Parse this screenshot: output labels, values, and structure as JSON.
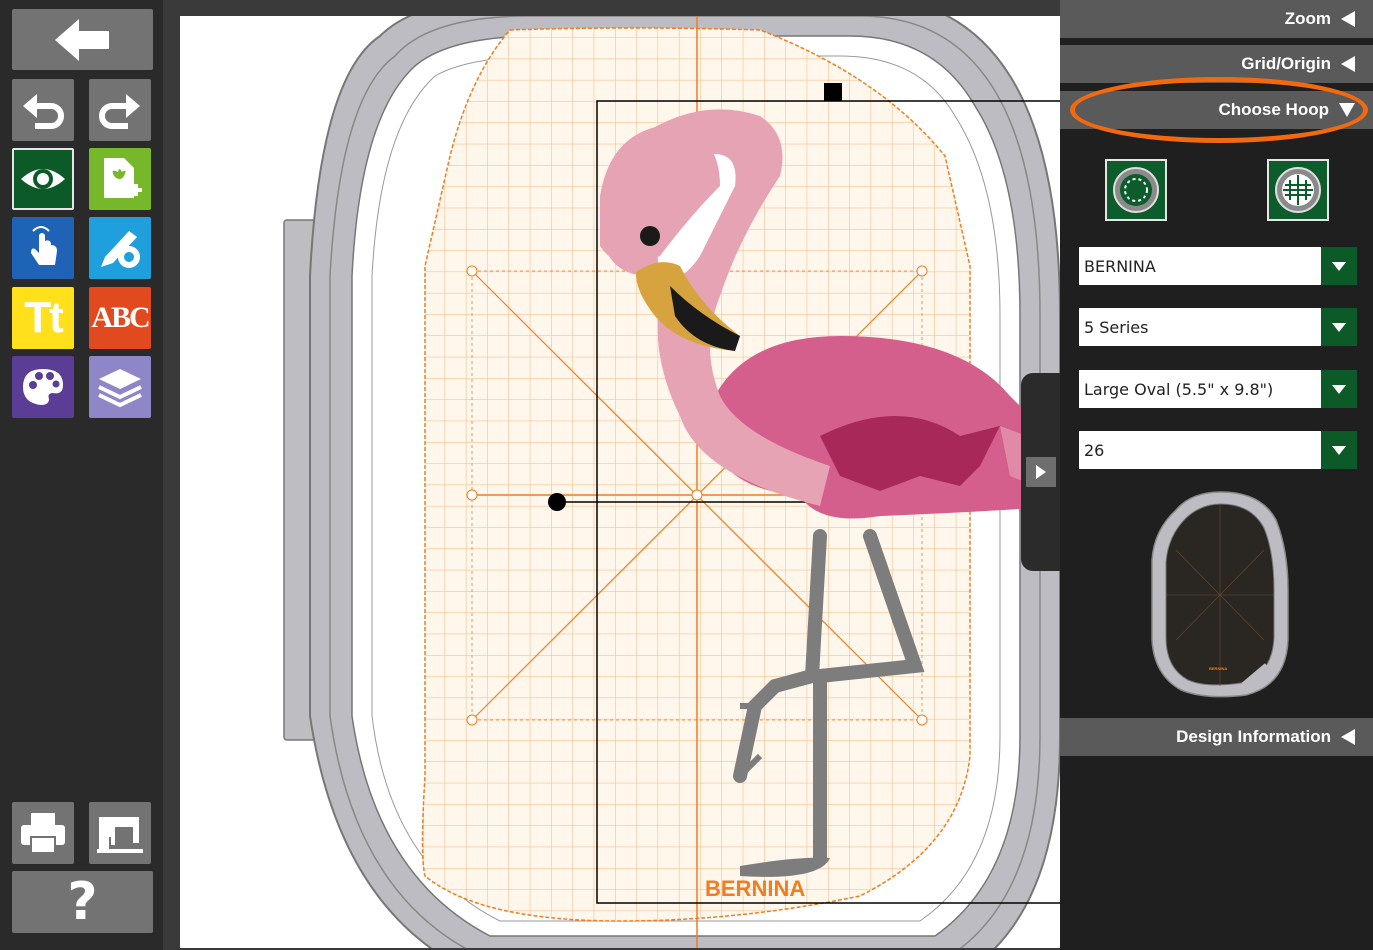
{
  "toolbar": {
    "back": "back-arrow-icon",
    "undo": "undo-icon",
    "redo": "redo-icon",
    "preview": "eye-icon",
    "add_design": "add-design-icon",
    "select": "hand-pointer-icon",
    "edit": "pencil-gear-icon",
    "text": "Tt",
    "monogram": "ABC",
    "colors": "palette-icon",
    "layers": "layers-icon",
    "print": "printer-icon",
    "send_machine": "sewing-machine-icon",
    "help": "?"
  },
  "canvas": {
    "hoop_logo": "BERNINA",
    "accent_color": "#f07d1f"
  },
  "panel": {
    "zoom_label": "Zoom",
    "grid_label": "Grid/Origin",
    "choose_hoop_label": "Choose Hoop",
    "design_info_label": "Design Information",
    "brand_value": "BERNINA",
    "series_value": "5 Series",
    "hoop_value": "Large Oval (5.5\" x 9.8\")",
    "number_value": "26",
    "preview_logo": "BERNINA"
  },
  "colors": {
    "accent_orange": "#f26a0f",
    "button_green": "#0b5a28",
    "text_yellow": "#ffe01a",
    "monogram_red": "#e04a1e",
    "select_blue": "#1e63b6",
    "edit_blue": "#1fa0dc",
    "palette_purple": "#5b3d96",
    "layers_purple": "#8f86c8"
  }
}
